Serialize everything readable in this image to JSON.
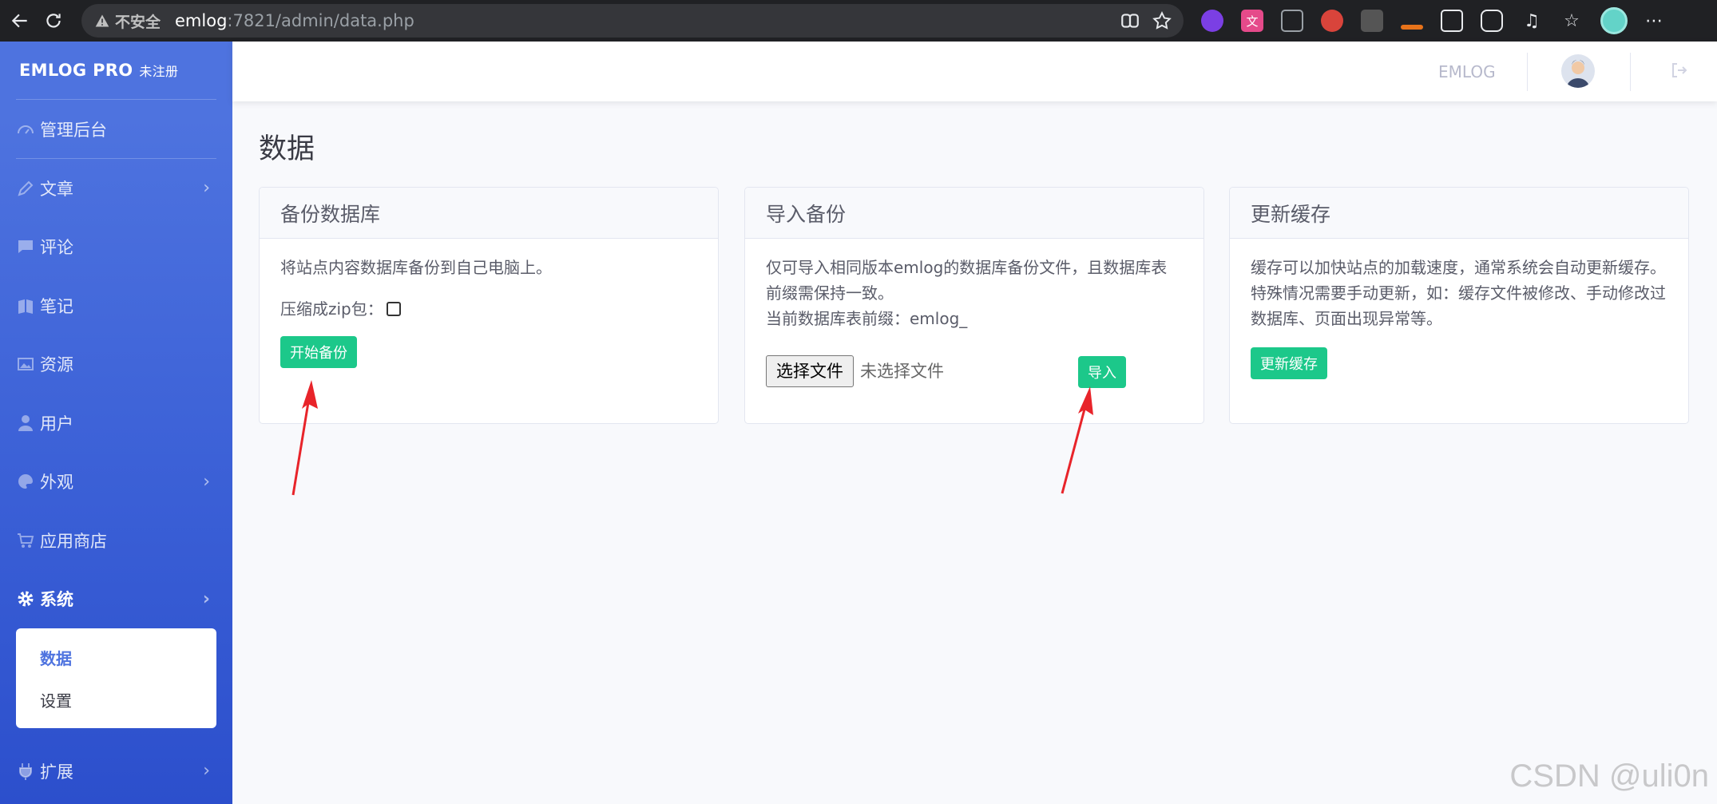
{
  "browser": {
    "security_label": "不安全",
    "url_host": "emlog",
    "url_rest": ":7821/admin/data.php"
  },
  "sidebar": {
    "brand": "EMLOG PRO",
    "brand_note": "未注册",
    "items": [
      {
        "label": "管理后台",
        "icon": "dashboard-icon"
      },
      {
        "label": "文章",
        "icon": "pencil-icon",
        "has_children": true
      },
      {
        "label": "评论",
        "icon": "comment-icon"
      },
      {
        "label": "笔记",
        "icon": "note-icon"
      },
      {
        "label": "资源",
        "icon": "image-icon"
      },
      {
        "label": "用户",
        "icon": "user-icon"
      },
      {
        "label": "外观",
        "icon": "palette-icon",
        "has_children": true
      },
      {
        "label": "应用商店",
        "icon": "cart-icon"
      },
      {
        "label": "系统",
        "icon": "gear-icon",
        "has_children": true,
        "active": true
      },
      {
        "label": "扩展",
        "icon": "plug-icon",
        "has_children": true
      }
    ],
    "submenu": [
      {
        "label": "数据",
        "current": true
      },
      {
        "label": "设置"
      }
    ]
  },
  "topbar": {
    "site_name": "EMLOG"
  },
  "page": {
    "title": "数据"
  },
  "cards": {
    "backup": {
      "title": "备份数据库",
      "description": "将站点内容数据库备份到自己电脑上。",
      "zip_label": "压缩成zip包：",
      "zip_checked": false,
      "button": "开始备份"
    },
    "import": {
      "title": "导入备份",
      "description": "仅可导入相同版本emlog的数据库备份文件，且数据库表前缀需保持一致。",
      "prefix_text": "当前数据库表前缀：emlog_",
      "file_button": "选择文件",
      "file_status": "未选择文件",
      "button": "导入"
    },
    "cache": {
      "title": "更新缓存",
      "description": "缓存可以加快站点的加载速度，通常系统会自动更新缓存。特殊情况需要手动更新，如：缓存文件被修改、手动修改过数据库、页面出现异常等。",
      "button": "更新缓存"
    }
  },
  "watermark": "CSDN @uli0n",
  "colors": {
    "sidebar": "#4e73df",
    "success": "#1cc88a",
    "annotation_arrow": "#e8242a"
  }
}
